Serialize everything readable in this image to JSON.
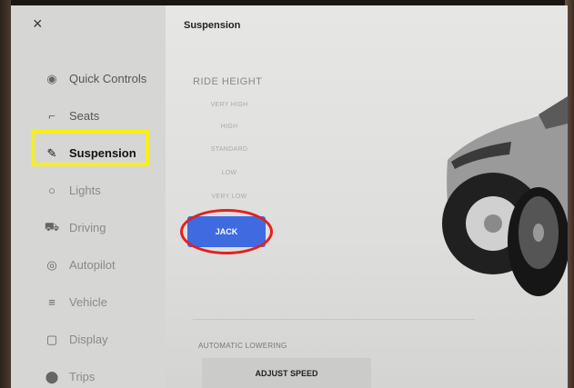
{
  "header": {
    "close_icon": "×",
    "title": "Suspension"
  },
  "sidebar": {
    "items": [
      {
        "label": "Quick Controls",
        "icon": "◉"
      },
      {
        "label": "Seats",
        "icon": "⌐"
      },
      {
        "label": "Suspension",
        "icon": "✎"
      },
      {
        "label": "Lights",
        "icon": "○"
      },
      {
        "label": "Driving",
        "icon": "⛟"
      },
      {
        "label": "Autopilot",
        "icon": "◎"
      },
      {
        "label": "Vehicle",
        "icon": "≡"
      },
      {
        "label": "Display",
        "icon": "▢"
      },
      {
        "label": "Trips",
        "icon": "⬤"
      }
    ]
  },
  "ride_height": {
    "title": "RIDE HEIGHT",
    "options": [
      "VERY HIGH",
      "HIGH",
      "STANDARD",
      "LOW",
      "VERY LOW"
    ],
    "jack_label": "JACK"
  },
  "automatic_lowering": {
    "label": "AUTOMATIC LOWERING",
    "button_label": "ADJUST SPEED"
  },
  "colors": {
    "accent": "#3f6be0",
    "highlight_yellow": "#f7ef1a",
    "highlight_red": "#e02121"
  }
}
